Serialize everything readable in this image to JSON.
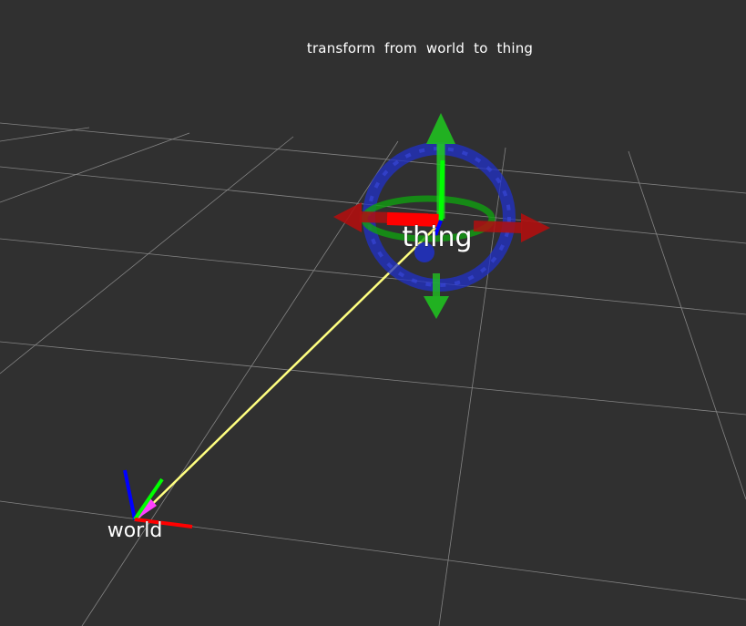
{
  "viewport": {
    "caption": "transform from world to thing",
    "background_color": "#303030",
    "grid_color": "#a0a0a0"
  },
  "frames": {
    "world": {
      "label": "world",
      "axis_colors": {
        "x": "#ff0000",
        "y": "#00ff00",
        "z": "#0000ff"
      }
    },
    "thing": {
      "label": "thing",
      "axis_colors": {
        "x": "#ff0000",
        "y": "#00ff00",
        "z": "#0000ff"
      }
    }
  },
  "tf_link": {
    "color": "#ffff80",
    "arrow_head_color": "#ff40ff"
  },
  "interactive_marker": {
    "rings": [
      "rotate-z-ring",
      "rotate-x-ring"
    ],
    "arrows": [
      "move-x-arrows",
      "move-y-arrows"
    ],
    "colors": {
      "x": "#ff0000",
      "y": "#00ff00",
      "z": "#0000ff"
    }
  }
}
